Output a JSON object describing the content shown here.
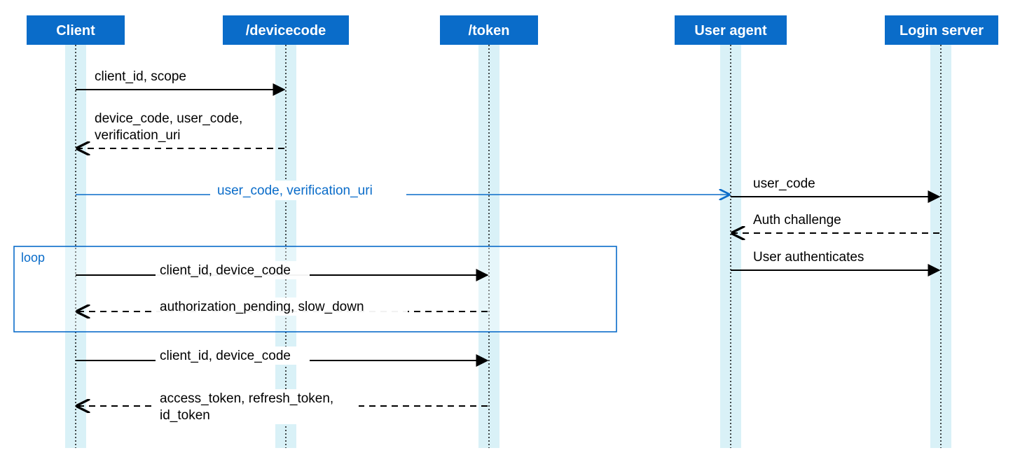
{
  "diagram": {
    "type": "sequence",
    "actors": {
      "client": "Client",
      "devicecode": "/devicecode",
      "token": "/token",
      "useragent": "User agent",
      "login": "Login server"
    },
    "loop_label": "loop",
    "messages": {
      "m1": "client_id, scope",
      "m2a": "device_code, user_code,",
      "m2b": "verification_uri",
      "m3": "user_code, verification_uri",
      "m4": "user_code",
      "m5": "Auth challenge",
      "m6": "User authenticates",
      "m7": "client_id, device_code",
      "m8": "authorization_pending, slow_down",
      "m9": "client_id, device_code",
      "m10a": "access_token, refresh_token,",
      "m10b": "id_token"
    }
  },
  "colors": {
    "accent": "#0A6CC9",
    "shade": "#D9F1F7"
  }
}
